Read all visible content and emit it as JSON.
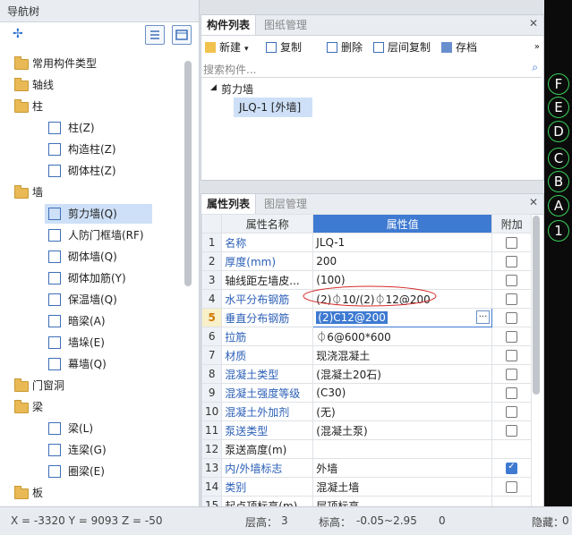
{
  "nav": {
    "title": "导航树",
    "items": [
      {
        "label": "常用构件类型",
        "type": "folder"
      },
      {
        "label": "轴线",
        "type": "folder"
      },
      {
        "label": "柱",
        "type": "folder"
      },
      {
        "label": "柱(Z)",
        "type": "leaf"
      },
      {
        "label": "构造柱(Z)",
        "type": "leaf"
      },
      {
        "label": "砌体柱(Z)",
        "type": "leaf"
      },
      {
        "label": "墙",
        "type": "folder"
      },
      {
        "label": "剪力墙(Q)",
        "type": "leaf"
      },
      {
        "label": "人防门框墙(RF)",
        "type": "leaf"
      },
      {
        "label": "砌体墙(Q)",
        "type": "leaf"
      },
      {
        "label": "砌体加筋(Y)",
        "type": "leaf"
      },
      {
        "label": "保温墙(Q)",
        "type": "leaf"
      },
      {
        "label": "暗梁(A)",
        "type": "leaf"
      },
      {
        "label": "墙垛(E)",
        "type": "leaf"
      },
      {
        "label": "幕墙(Q)",
        "type": "leaf"
      },
      {
        "label": "门窗洞",
        "type": "folder"
      },
      {
        "label": "梁",
        "type": "folder"
      },
      {
        "label": "梁(L)",
        "type": "leaf"
      },
      {
        "label": "连梁(G)",
        "type": "leaf"
      },
      {
        "label": "圈梁(E)",
        "type": "leaf"
      },
      {
        "label": "板",
        "type": "folder"
      }
    ]
  },
  "component_panel": {
    "tabs": [
      "构件列表",
      "图纸管理"
    ],
    "toolbar": {
      "new": "新建",
      "copy": "复制",
      "delete": "删除",
      "floor_copy": "层间复制",
      "save": "存档"
    },
    "search_placeholder": "搜索构件...",
    "tree_group": "剪力墙",
    "tree_item": "JLQ-1 [外墙]"
  },
  "property_panel": {
    "tabs": [
      "属性列表",
      "图层管理"
    ],
    "headers": {
      "name": "属性名称",
      "value": "属性值",
      "extra": "附加"
    },
    "rows": [
      {
        "n": "1",
        "name": "名称",
        "value": "JLQ-1"
      },
      {
        "n": "2",
        "name": "厚度(mm)",
        "value": "200"
      },
      {
        "n": "3",
        "name": "轴线距左墙皮...",
        "value": "(100)"
      },
      {
        "n": "4",
        "name": "水平分布钢筋",
        "value": "(2)⏀10/(2)⏀12@200"
      },
      {
        "n": "5",
        "name": "垂直分布钢筋",
        "value": "(2)C12@200"
      },
      {
        "n": "6",
        "name": "拉筋",
        "value": "⏀6@600*600"
      },
      {
        "n": "7",
        "name": "材质",
        "value": "现浇混凝土"
      },
      {
        "n": "8",
        "name": "混凝土类型",
        "value": "(混凝土20石)"
      },
      {
        "n": "9",
        "name": "混凝土强度等级",
        "value": "(C30)"
      },
      {
        "n": "10",
        "name": "混凝土外加剂",
        "value": "(无)"
      },
      {
        "n": "11",
        "name": "泵送类型",
        "value": "(混凝土泵)"
      },
      {
        "n": "12",
        "name": "泵送高度(m)",
        "value": ""
      },
      {
        "n": "13",
        "name": "内/外墙标志",
        "value": "外墙"
      },
      {
        "n": "14",
        "name": "类别",
        "value": "混凝土墙"
      },
      {
        "n": "15",
        "name": "起点顶标高(m)",
        "value": "层顶标高"
      }
    ],
    "edit_button": "···"
  },
  "canvas": {
    "axis_labels": [
      "F",
      "E",
      "D",
      "C",
      "B",
      "A",
      "1"
    ]
  },
  "status": {
    "coords": "X = -3320 Y = 9093 Z = -50",
    "floor_height_label": "层高：",
    "floor_height": "3",
    "elevation_label": "标高：",
    "elevation": "-0.05~2.95",
    "count": "0",
    "hidden_label": "隐藏：",
    "hidden": "0"
  }
}
